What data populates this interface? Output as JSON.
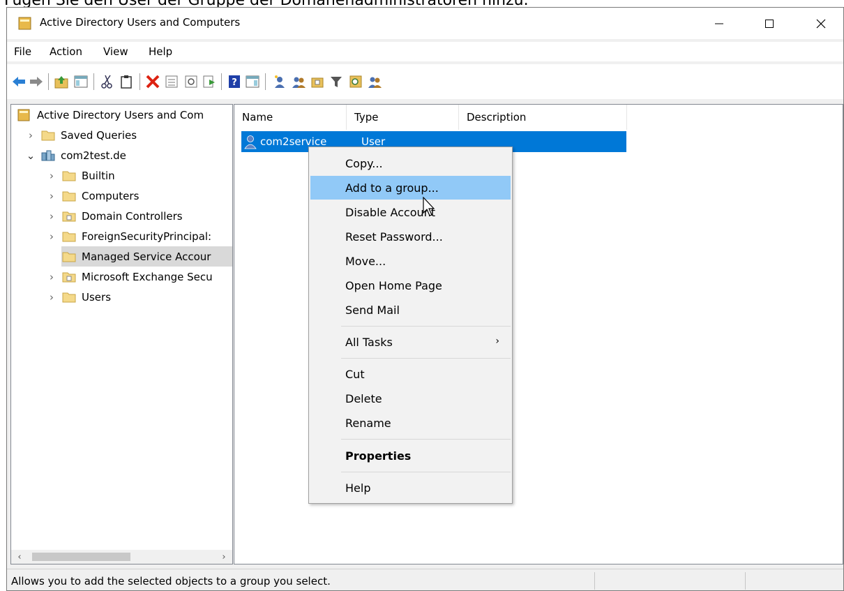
{
  "caption": "Fügen Sie den User der Gruppe der Domänenadministratoren hinzu.",
  "window": {
    "title": "Active Directory Users and Computers",
    "controls": [
      "minimize-icon",
      "maximize-icon",
      "close-icon"
    ]
  },
  "menu": [
    "File",
    "Action",
    "View",
    "Help"
  ],
  "toolbar_icons": [
    "back-icon",
    "forward-icon",
    "up-folder-icon",
    "show-console-tree-icon",
    "cut-icon",
    "paste-icon",
    "delete-icon",
    "properties-icon",
    "refresh-icon",
    "export-list-icon",
    "help-icon",
    "show-action-pane-icon",
    "new-user-icon",
    "new-group-icon",
    "new-ou-icon",
    "filter-icon",
    "find-icon",
    "add-to-group-icon"
  ],
  "tree": {
    "root": "Active Directory Users and Com",
    "items": [
      {
        "label": "Saved Queries",
        "expander": "›",
        "icon": "folder-icon"
      },
      {
        "label": "com2test.de",
        "expander": "⌄",
        "icon": "domain-icon"
      },
      {
        "label": "Builtin",
        "expander": "›",
        "icon": "folder-icon"
      },
      {
        "label": "Computers",
        "expander": "›",
        "icon": "folder-icon"
      },
      {
        "label": "Domain Controllers",
        "expander": "›",
        "icon": "ou-icon"
      },
      {
        "label": "ForeignSecurityPrincipal:",
        "expander": "›",
        "icon": "folder-icon"
      },
      {
        "label": "Managed Service Accour",
        "expander": "",
        "icon": "folder-icon"
      },
      {
        "label": "Microsoft Exchange Secu",
        "expander": "›",
        "icon": "ou-icon"
      },
      {
        "label": "Users",
        "expander": "›",
        "icon": "folder-icon"
      }
    ]
  },
  "list": {
    "columns": [
      "Name",
      "Type",
      "Description"
    ],
    "rows": [
      {
        "name": "com2service",
        "type": "User",
        "description": ""
      }
    ]
  },
  "context_menu": {
    "items": [
      {
        "label": "Copy..."
      },
      {
        "label": "Add to a group..."
      },
      {
        "label": "Disable Account"
      },
      {
        "label": "Reset Password..."
      },
      {
        "label": "Move..."
      },
      {
        "label": "Open Home Page"
      },
      {
        "label": "Send Mail"
      },
      {
        "label": "All Tasks",
        "submenu_arrow": "›"
      },
      {
        "label": "Cut"
      },
      {
        "label": "Delete"
      },
      {
        "label": "Rename"
      },
      {
        "label": "Properties"
      },
      {
        "label": "Help"
      }
    ]
  },
  "status": {
    "text": "Allows you to add the selected objects to a group you select."
  },
  "scroll": {
    "left": "‹",
    "right": "›"
  },
  "colors": {
    "selection": "#0078d7",
    "menu_hover": "#91c9f7",
    "tree_selected": "#d9d9d9"
  }
}
